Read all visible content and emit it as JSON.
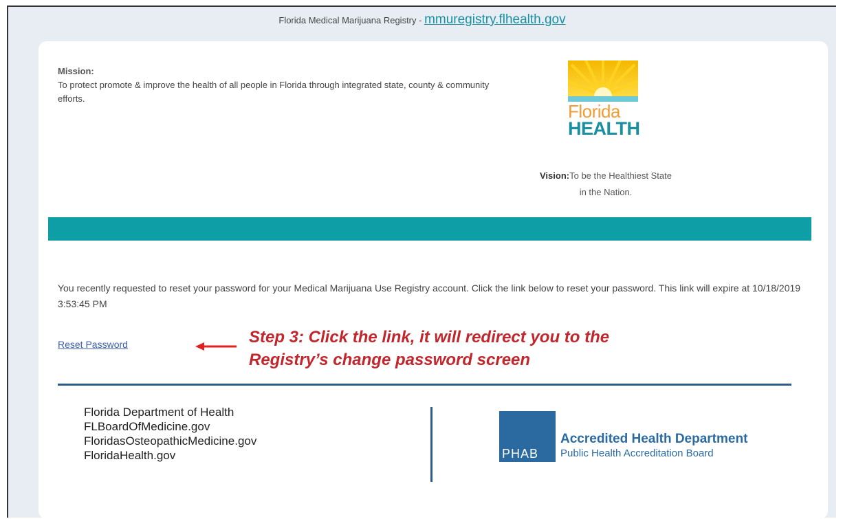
{
  "header": {
    "prefix": "Florida Medical Marijuana Registry - ",
    "site_link": "mmuregistry.flhealth.gov"
  },
  "mission": {
    "heading": "Mission:",
    "text": "To protect promote & improve the health of all people in Florida through integrated state, county & community efforts."
  },
  "logo": {
    "word1": "Florida",
    "word2": "HEALTH"
  },
  "vision": {
    "label": "Vision:",
    "text": "To be the Healthiest State",
    "text2": "in the Nation."
  },
  "message": {
    "body": "You recently requested to reset your password for your Medical Marijuana Use Registry account. Click the link below to reset your password. This link will expire at 10/18/2019 3:53:45 PM"
  },
  "reset_link": "Reset Password",
  "annotation": {
    "line1": "Step 3: Click the link, it will redirect you to the",
    "line2": "Registry’s change password screen"
  },
  "footer": {
    "links": [
      "Florida Department of Health",
      "FLBoardOfMedicine.gov",
      "FloridasOsteopathicMedicine.gov",
      "FloridaHealth.gov"
    ],
    "phab_letters": "PHAB",
    "phab_title": "Accredited Health Department",
    "phab_subtitle": "Public Health Accreditation Board"
  },
  "colors": {
    "teal": "#0e9ea6",
    "annotation_red": "#c0262b",
    "navy": "#2d5a88",
    "link_blue": "#3a5fb0"
  }
}
